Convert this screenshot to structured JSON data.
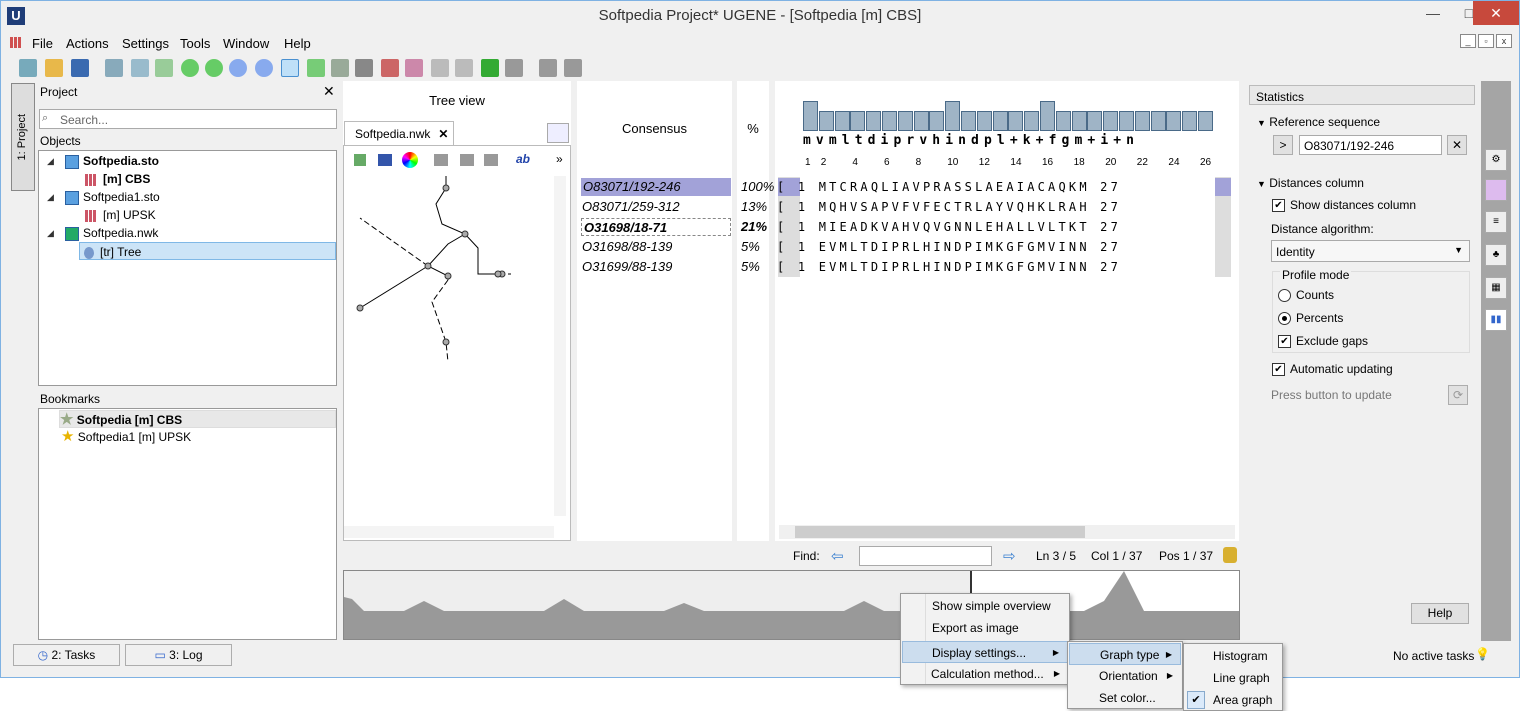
{
  "window": {
    "title": "Softpedia Project* UGENE - [Softpedia [m] CBS]",
    "logo": "U"
  },
  "menu": [
    "File",
    "Actions",
    "Settings",
    "Tools",
    "Window",
    "Help"
  ],
  "left_tab": "1: Project",
  "project": {
    "header": "Project",
    "search_placeholder": "Search...",
    "objects_label": "Objects",
    "items": [
      {
        "label": "Softpedia.sto",
        "bold": true
      },
      {
        "label": "[m] CBS",
        "bold": true
      },
      {
        "label": "Softpedia1.sto",
        "bold": false
      },
      {
        "label": "[m] UPSK",
        "bold": false
      },
      {
        "label": "Softpedia.nwk",
        "bold": false
      },
      {
        "label": "[tr] Tree",
        "bold": false
      }
    ],
    "bookmarks_label": "Bookmarks",
    "bookmarks": [
      "Softpedia [m] CBS",
      "Softpedia1 [m] UPSK"
    ]
  },
  "tree": {
    "title": "Tree view",
    "tab": "Softpedia.nwk"
  },
  "alignment": {
    "consensus_label": "Consensus",
    "pct_label": "%",
    "consensus_seq": "mvmltdiprvhindpl+k+fgm+i+n",
    "ruler": [
      "1",
      "2",
      "4",
      "6",
      "8",
      "10",
      "12",
      "14",
      "16",
      "18",
      "20",
      "22",
      "24",
      "26"
    ],
    "names": [
      "O83071/192-246",
      "O83071/259-312",
      "O31698/18-71",
      "O31698/88-139",
      "O31699/88-139"
    ],
    "percents": [
      "100%",
      "13%",
      "21%",
      "5%",
      "5%"
    ],
    "row_prefix": "[ 1",
    "rows": [
      "MTCRAQLIAVPRASSLAEAIACAQKM",
      "MQHVSAPVFVFECTRLAYVQHKLRAH",
      "MIEADKVAHVQVGNNLEHALLVLTKT",
      "EVMLTDIPRLHINDPIMKGFGMVINN",
      "EVMLTDIPRLHINDPIMKGFGMVINN"
    ],
    "row_suffix": "27",
    "find_label": "Find:",
    "status": {
      "ln": "Ln 3 / 5",
      "col": "Col 1 / 37",
      "pos": "Pos 1 / 37"
    }
  },
  "stats": {
    "header": "Statistics",
    "ref_label": "Reference sequence",
    "ref_value": "O83071/192-246",
    "dist_label": "Distances column",
    "show_dist": "Show distances column",
    "algo_label": "Distance algorithm:",
    "algo_value": "Identity",
    "profile_label": "Profile mode",
    "counts": "Counts",
    "percents": "Percents",
    "exclude_gaps": "Exclude gaps",
    "auto_update": "Automatic updating",
    "press_update": "Press button to update",
    "help": "Help"
  },
  "context_menu": {
    "main": [
      "Show simple overview",
      "Export as image",
      "Display settings...",
      "Calculation method..."
    ],
    "sub1": [
      "Graph type",
      "Orientation",
      "Set color..."
    ],
    "sub2": [
      "Histogram",
      "Line graph",
      "Area graph"
    ]
  },
  "statusbar": {
    "tasks": "2: Tasks",
    "log": "3: Log",
    "no_tasks": "No active tasks"
  }
}
